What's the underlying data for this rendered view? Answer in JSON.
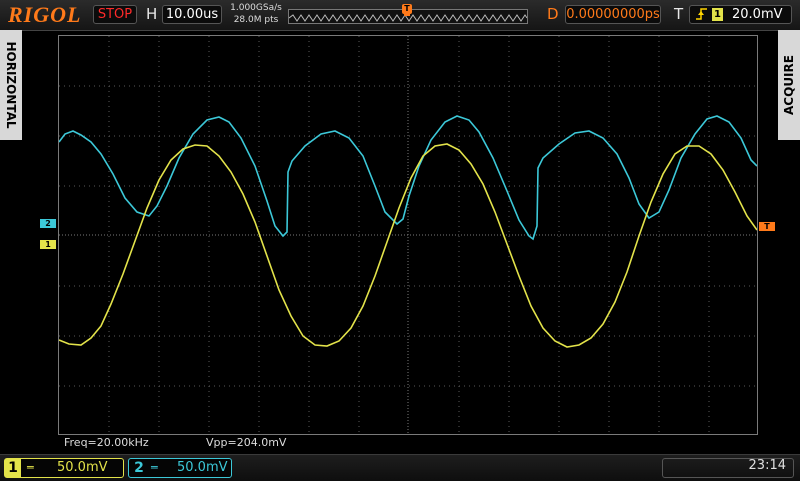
{
  "brand": "RIGOL",
  "status": "STOP",
  "horizontal": {
    "label": "H",
    "timebase": "10.00us",
    "sample_rate": "1.000GSa/s",
    "mem_depth": "28.0M pts"
  },
  "delay": {
    "label": "D",
    "value": "0.00000000ps"
  },
  "trigger": {
    "label": "T",
    "channel": "1",
    "level": "20.0mV"
  },
  "side_tabs": {
    "left": "HORIZONTAL",
    "right": "ACQUIRE"
  },
  "measurements": {
    "freq": "Freq=20.00kHz",
    "vpp": "Vpp=204.0mV"
  },
  "channels": [
    {
      "num": "1",
      "scale": "50.0mV",
      "color": "#e3e34a"
    },
    {
      "num": "2",
      "scale": "50.0mV",
      "color": "#3cc8d8"
    }
  ],
  "markers": {
    "ch1": "1",
    "ch2": "2",
    "trig_top": "T",
    "trig_right": "T"
  },
  "clock": "23:14",
  "colors": {
    "accent": "#ff7a1a",
    "stop": "#ff2a2a",
    "ch1": "#e3e34a",
    "ch2": "#3cc8d8",
    "grid": "#5a5a5a"
  },
  "icons": [
    "rising-edge-icon",
    "waveform-memory-icon"
  ]
}
